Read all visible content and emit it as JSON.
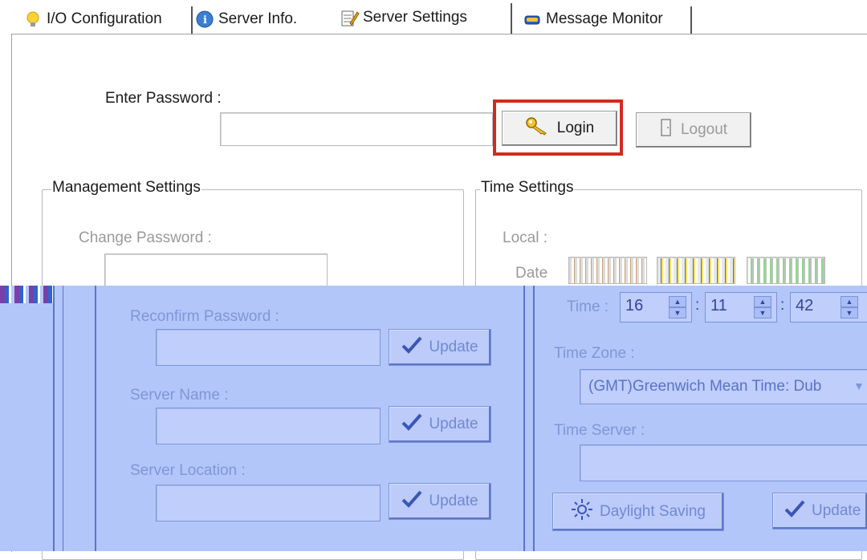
{
  "tabs": [
    {
      "label": "I/O Configuration",
      "icon": "lightbulb-icon"
    },
    {
      "label": "Server Info.",
      "icon": "info-icon"
    },
    {
      "label": "Server Settings",
      "icon": "settings-pencil-icon",
      "active": true
    },
    {
      "label": "Message Monitor",
      "icon": "monitor-icon"
    }
  ],
  "login": {
    "password_label": "Enter Password :",
    "password_value": "",
    "login_label": "Login",
    "logout_label": "Logout"
  },
  "management": {
    "title": "Management Settings",
    "change_password_label": "Change Password :",
    "reconfirm_password_label": "Reconfirm Password :",
    "server_name_label": "Server Name :",
    "server_location_label": "Server Location :",
    "update_label": "Update"
  },
  "time": {
    "title": "Time Settings",
    "local_label": "Local :",
    "date_label": "Date",
    "time_label": "Time :",
    "hour": "16",
    "minute": "11",
    "second": "42",
    "timezone_label": "Time Zone :",
    "timezone_value": "(GMT)Greenwich Mean Time: Dub",
    "timeserver_label": "Time Server :",
    "timeserver_value": "",
    "daylight_label": "Daylight Saving",
    "update_label": "Update"
  },
  "colors": {
    "highlight_border": "#d42a1e",
    "tint_overlay": "#b3c6fa",
    "disabled_text": "#9a9a9a"
  }
}
